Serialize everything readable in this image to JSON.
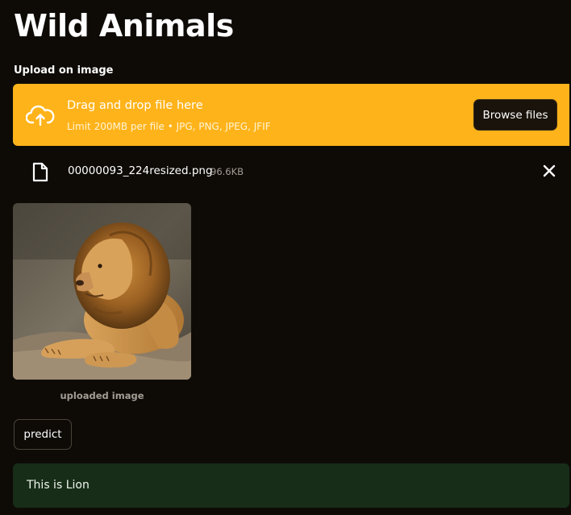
{
  "page": {
    "title": "Wild Animals"
  },
  "uploader": {
    "label": "Upload on image",
    "drop_text": "Drag and drop file here",
    "limit_text": "Limit 200MB per file • JPG, PNG, JPEG, JFIF",
    "browse_label": "Browse files",
    "accent_color": "#ffb31a"
  },
  "file": {
    "name": "00000093_224resized.png",
    "size": "96.6KB",
    "icon": "file-icon",
    "remove_icon": "close-icon"
  },
  "image": {
    "caption": "uploaded image"
  },
  "actions": {
    "predict_label": "predict"
  },
  "result": {
    "text": "This is Lion",
    "background_color": "#172d18"
  }
}
